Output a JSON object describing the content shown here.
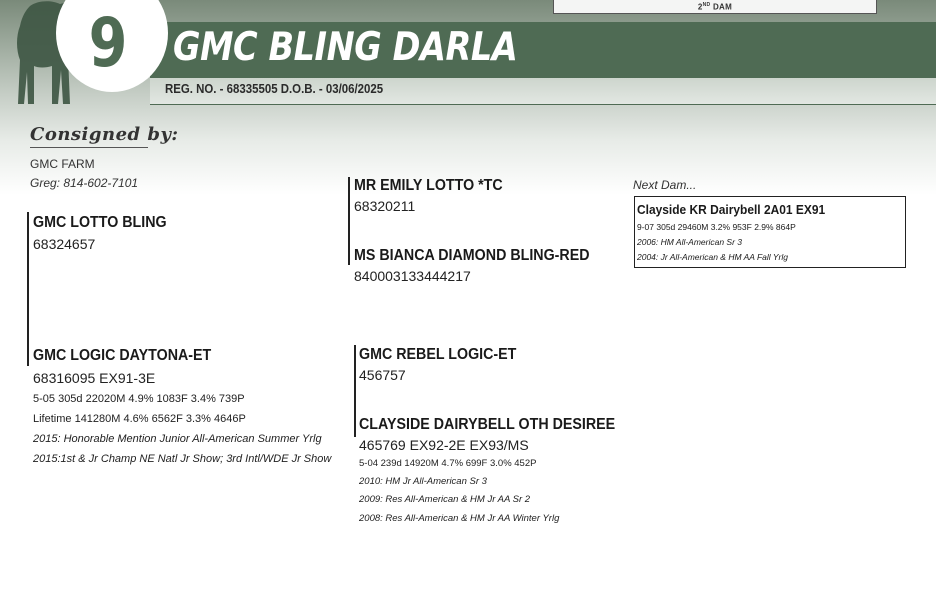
{
  "header": {
    "second_dam_label_base": "2",
    "second_dam_label_sup": "ND",
    "second_dam_label_rest": " DAM",
    "lot_number": "9",
    "animal_name": "GMC BLING DARLA",
    "reg_line": "REG. NO. - 68335505    D.O.B. - 03/06/2025"
  },
  "consignor": {
    "title": "Consigned by:",
    "farm": "GMC FARM",
    "contact": "Greg: 814-602-7101"
  },
  "sire": {
    "name": "GMC LOTTO BLING",
    "reg": "68324657"
  },
  "sire_sire": {
    "name": "MR EMILY LOTTO *TC",
    "reg": "68320211"
  },
  "sire_dam": {
    "name": "MS BIANCA DIAMOND BLING-RED",
    "reg": "840003133444217"
  },
  "dam": {
    "name": "GMC LOGIC DAYTONA-ET",
    "reg": "68316095   EX91-3E",
    "record": "5-05 305d 22020M 4.9% 1083F 3.4% 739P",
    "lifetime": "Lifetime 141280M 4.6% 6562F 3.3% 4646P",
    "honors": [
      "2015: Honorable Mention Junior All-American Summer Yrlg",
      "2015:1st & Jr Champ NE Natl Jr Show; 3rd Intl/WDE Jr Show"
    ]
  },
  "dam_sire": {
    "name": "GMC REBEL LOGIC-ET",
    "reg": "456757"
  },
  "dam_dam": {
    "name": "CLAYSIDE DAIRYBELL OTH DESIREE",
    "reg": "465769   EX92-2E EX93/MS",
    "record": "5-04 239d 14920M 4.7% 699F 3.0% 452P",
    "honors": [
      "2010: HM Jr All-American Sr 3",
      "2009: Res All-American & HM Jr AA Sr 2",
      "2008: Res All-American & HM Jr AA Winter Yrlg"
    ]
  },
  "next_dam": {
    "label": "Next Dam...",
    "name": "Clayside KR Dairybell 2A01 EX91",
    "record": "9-07 305d 29460M 3.2% 953F 2.9% 864P",
    "honors": [
      "2006: HM All-American Sr 3",
      "2004: Jr All-American & HM AA Fall Yrlg"
    ]
  },
  "colors": {
    "brand_green": "#4f6b54",
    "text": "#1a1a1a"
  }
}
